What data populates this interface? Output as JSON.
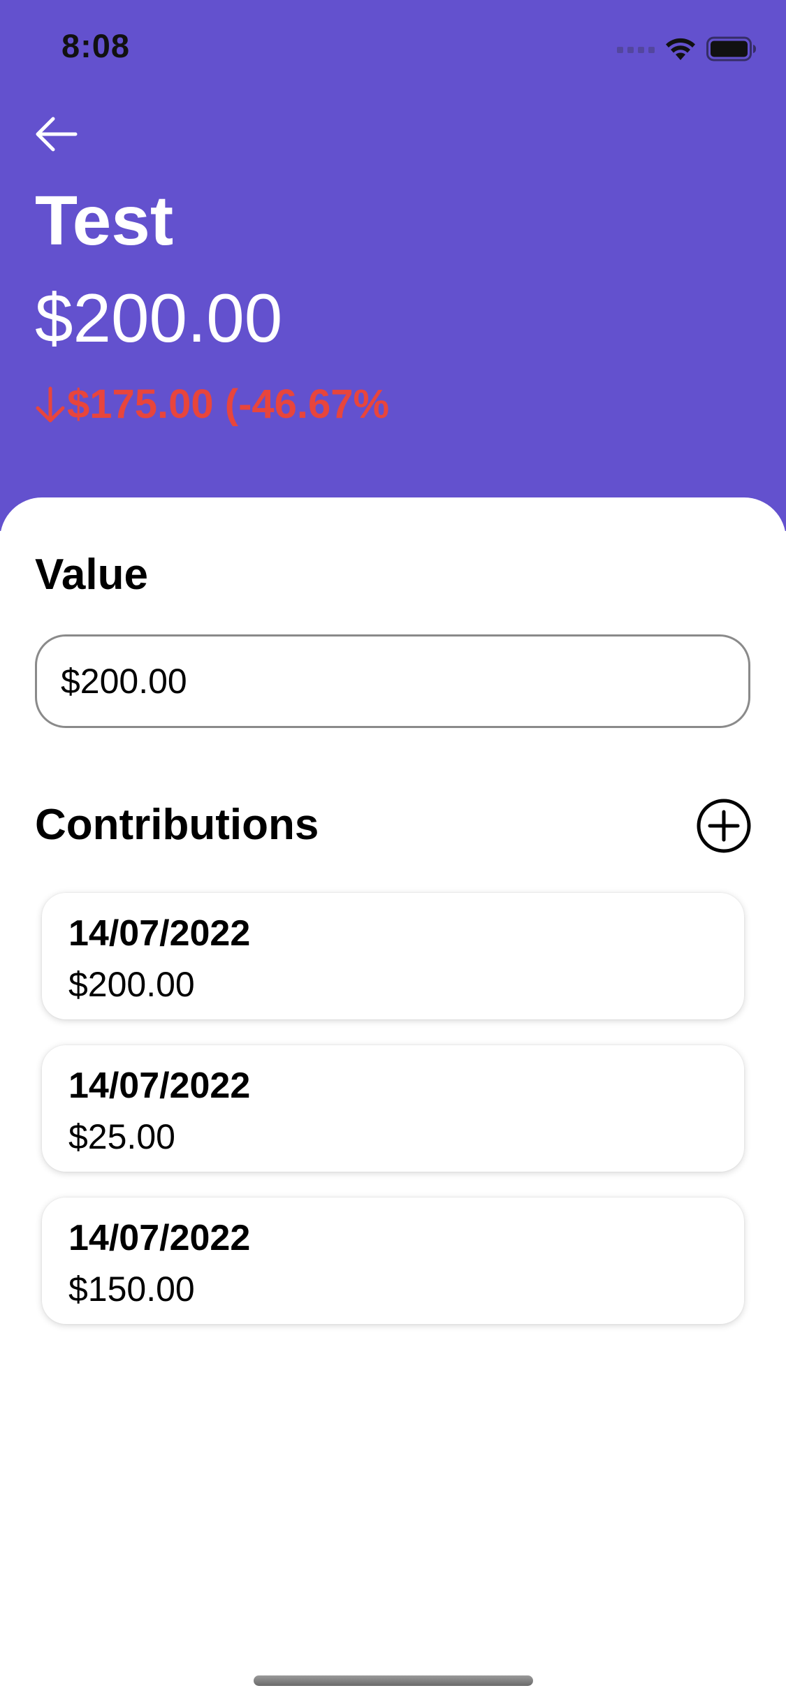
{
  "status_bar": {
    "time": "8:08",
    "icons": [
      "cellular-signal-icon",
      "wifi-icon",
      "battery-icon"
    ]
  },
  "header": {
    "back_icon": "arrow-left-icon",
    "title": "Test",
    "amount": "$200.00",
    "change": {
      "direction_icon": "arrow-down-icon",
      "text": "$175.00 (-46.67%",
      "color": "#E8453C"
    },
    "background_color": "#6351CE"
  },
  "value_section": {
    "label": "Value",
    "input_value": "$200.00"
  },
  "contributions_section": {
    "label": "Contributions",
    "add_icon": "plus-circle-icon",
    "items": [
      {
        "date": "14/07/2022",
        "amount": "$200.00"
      },
      {
        "date": "14/07/2022",
        "amount": "$25.00"
      },
      {
        "date": "14/07/2022",
        "amount": "$150.00"
      }
    ]
  }
}
